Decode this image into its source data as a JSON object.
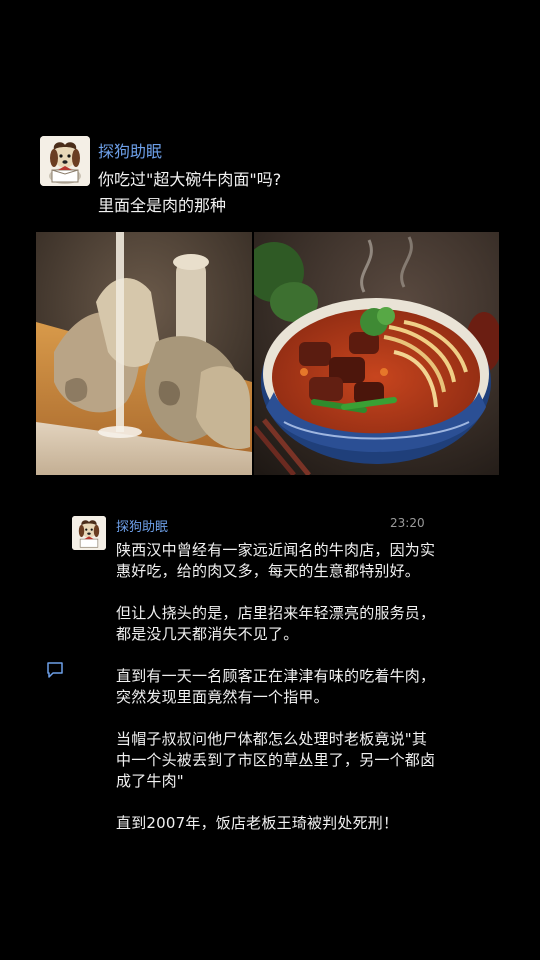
{
  "post": {
    "username": "探狗助眠",
    "title_line1": "你吃过\"超大碗牛肉面\"吗?",
    "title_line2": "里面全是肉的那种"
  },
  "images": [
    {
      "name": "bone-broth-photo"
    },
    {
      "name": "beef-noodle-bowl-photo"
    }
  ],
  "reply": {
    "username": "探狗助眠",
    "time": "23:20",
    "paragraphs": [
      "陕西汉中曾经有一家远近闻名的牛肉店，因为实惠好吃，给的肉又多，每天的生意都特别好。",
      "但让人挠头的是，店里招来年轻漂亮的服务员，都是没几天都消失不见了。",
      "直到有一天一名顾客正在津津有味的吃着牛肉，突然发现里面竟然有一个指甲。",
      "当帽子叔叔问他尸体都怎么处理时老板竟说\"其中一个头被丢到了市区的草丛里了，另一个都卤成了牛肉\"",
      "直到2007年，饭店老板王琦被判处死刑！"
    ]
  },
  "icons": {
    "comment": "comment-icon"
  },
  "colors": {
    "background": "#000000",
    "username": "#6d9fe8",
    "text": "#f2f2f2",
    "time": "#9a9a9a"
  }
}
